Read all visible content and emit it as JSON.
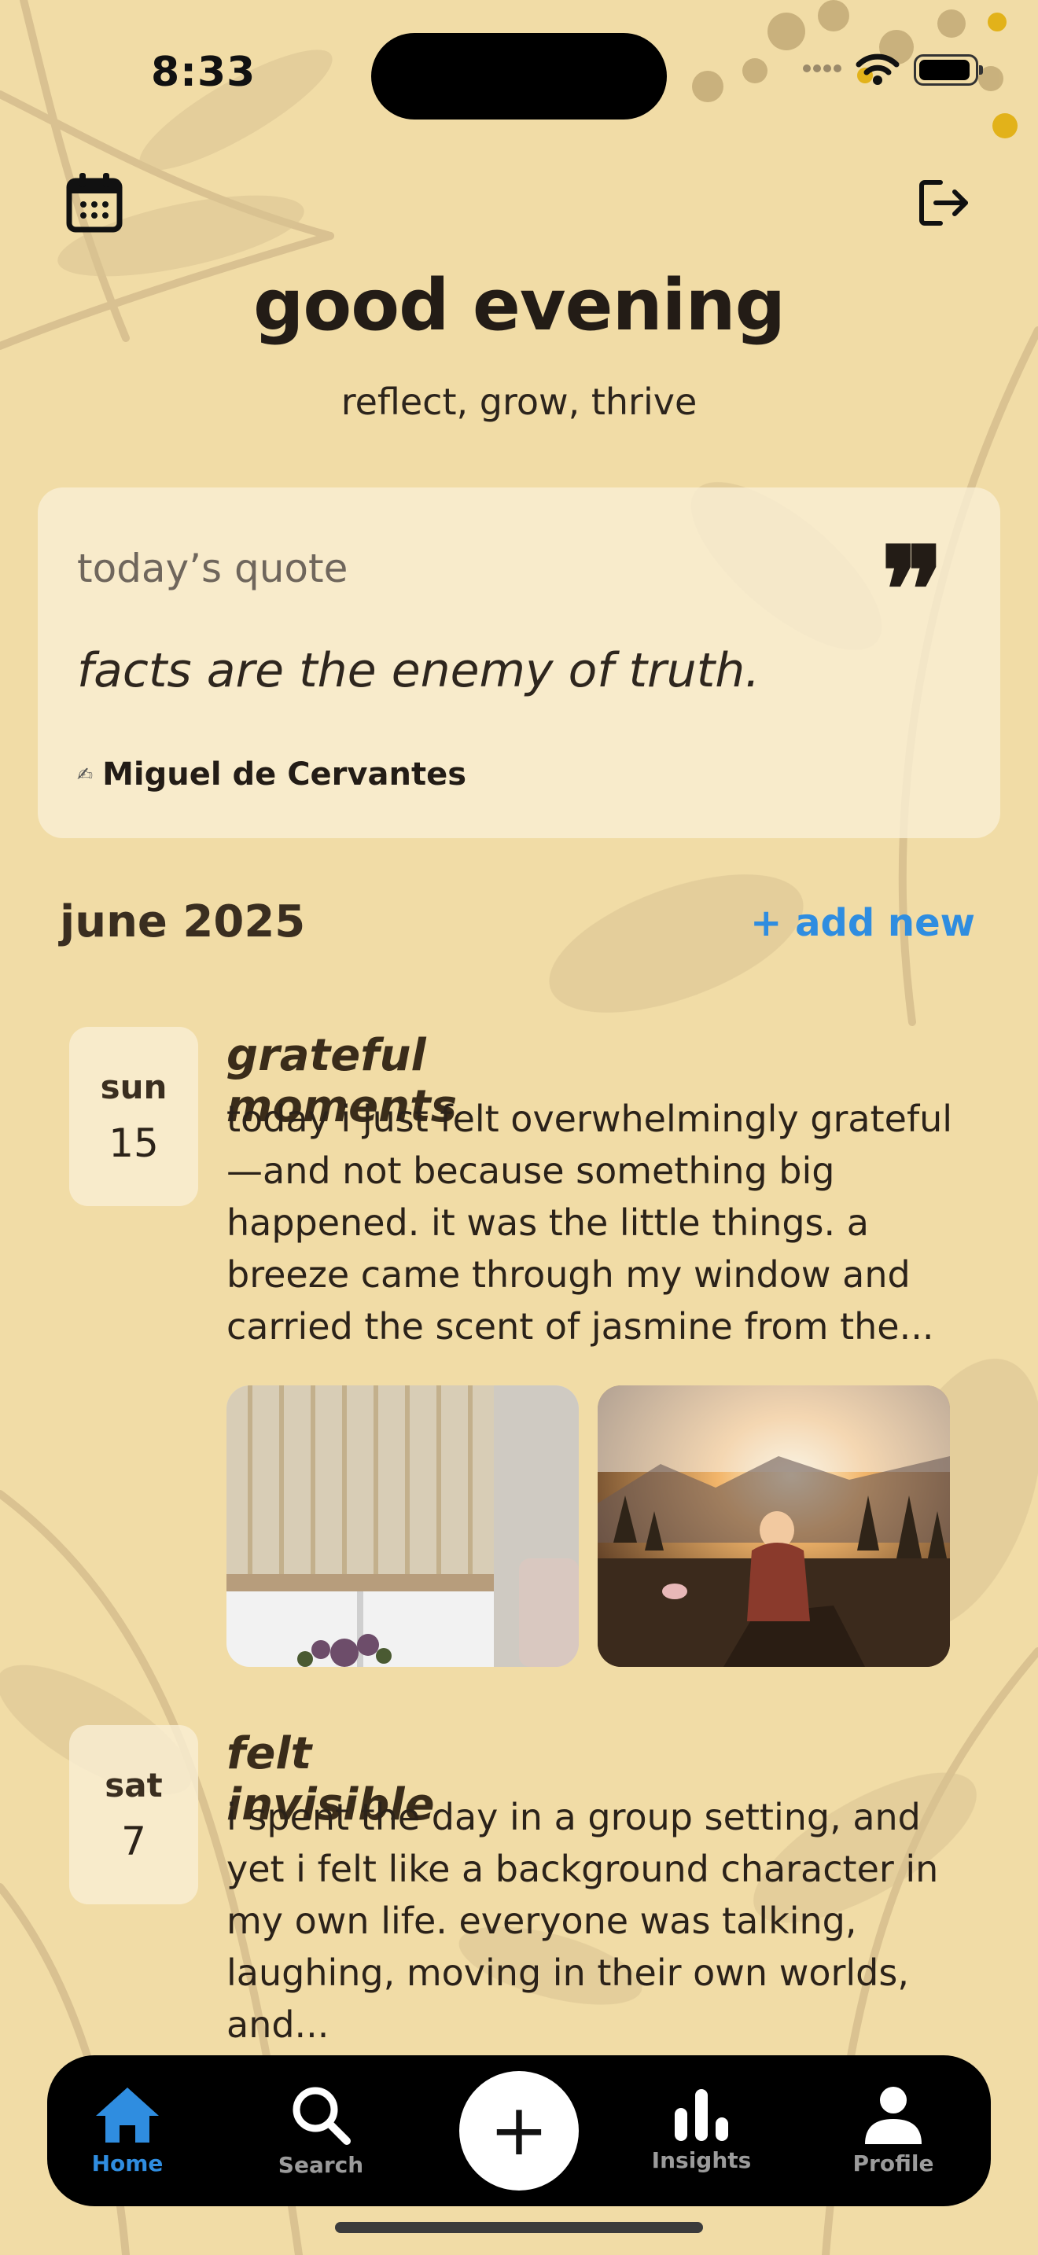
{
  "status_bar": {
    "time": "8:33"
  },
  "header": {
    "calendar_icon": "calendar-icon",
    "logout_icon": "logout-icon",
    "greeting": "good evening",
    "tagline": "reflect, grow, thrive"
  },
  "quote": {
    "label": "today’s quote",
    "mark": "❞",
    "text": "facts are the enemy of truth.",
    "author": "Miguel de Cervantes"
  },
  "month": {
    "title": "june 2025",
    "add_new": "+ add new"
  },
  "entries": [
    {
      "dow": "sun",
      "day": "15",
      "title": "grateful moments",
      "body": "today i just felt overwhelmingly grateful—and not because something big happened. it was the little things. a breeze came through my window and carried the scent of jasmine from the..."
    },
    {
      "dow": "sat",
      "day": "7",
      "title": "felt invisible",
      "body": "i spent the day in a group setting, and yet i felt like a background character in my own life. everyone was talking, laughing, moving in their own worlds, and..."
    }
  ],
  "tabbar": {
    "home": "Home",
    "search": "Search",
    "add": "+",
    "insights": "Insights",
    "profile": "Profile"
  },
  "colors": {
    "background": "#f1dca6",
    "accent": "#2f8de0",
    "tabbar": "#000000"
  }
}
